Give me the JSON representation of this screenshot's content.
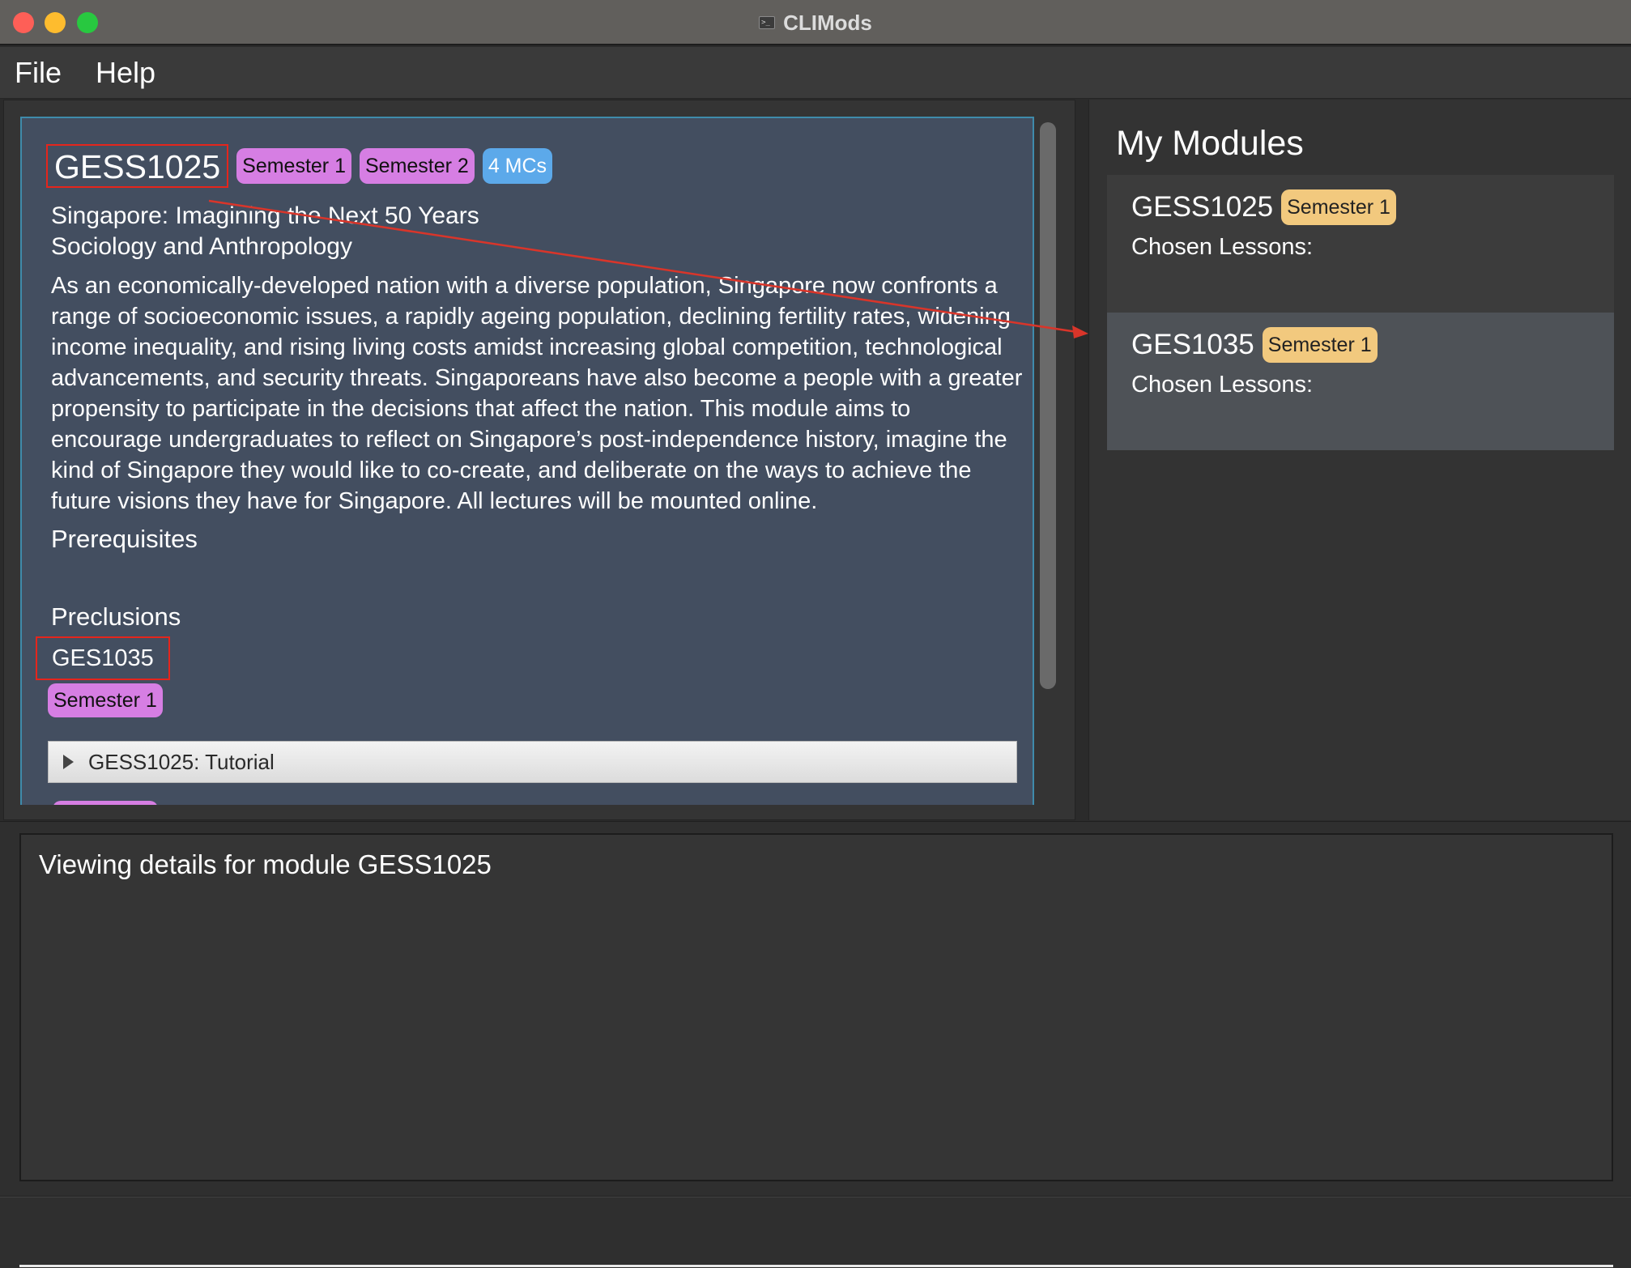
{
  "window": {
    "title": "CLIMods"
  },
  "menu": {
    "file": "File",
    "help": "Help"
  },
  "module_detail": {
    "code": "GESS1025",
    "semester_tags": [
      "Semester 1",
      "Semester 2"
    ],
    "mc_tag": "4 MCs",
    "title": "Singapore: Imagining the Next 50 Years",
    "department": "Sociology and Anthropology",
    "description": "As an economically-developed nation with a diverse population, Singapore now confronts a range of socioeconomic issues, a rapidly ageing population, declining fertility rates, widening income inequality, and rising living costs amidst increasing global competition, technological advancements, and security threats. Singaporeans have also become a people with a greater propensity to participate in the decisions that affect the nation. This module aims to encourage undergraduates to reflect on Singapore’s post-independence history, imagine the kind of Singapore they would like  to co-create, and deliberate on the ways to achieve the future visions they have for Singapore. All lectures will be mounted online.",
    "prerequisites_heading": "Prerequisites",
    "preclusions_heading": "Preclusions",
    "preclusion_code": "GES1035",
    "preclusion_semester": "Semester 1",
    "lesson_group": "GESS1025: Tutorial"
  },
  "my_modules": {
    "heading": "My Modules",
    "items": [
      {
        "code": "GESS1025",
        "semester": "Semester 1",
        "lessons_label": "Chosen Lessons:"
      },
      {
        "code": "GES1035",
        "semester": "Semester 1",
        "lessons_label": "Chosen Lessons:"
      }
    ]
  },
  "result": {
    "message": "Viewing details for module GESS1025"
  },
  "command": {
    "value": "",
    "placeholder": ""
  },
  "colors": {
    "semester_tag": "#d67ee3",
    "mc_tag": "#5ca9ea",
    "my_module_semester_tag": "#f2c97e",
    "highlight_box": "#e5251c",
    "annotation_arrow": "#d9352a"
  }
}
